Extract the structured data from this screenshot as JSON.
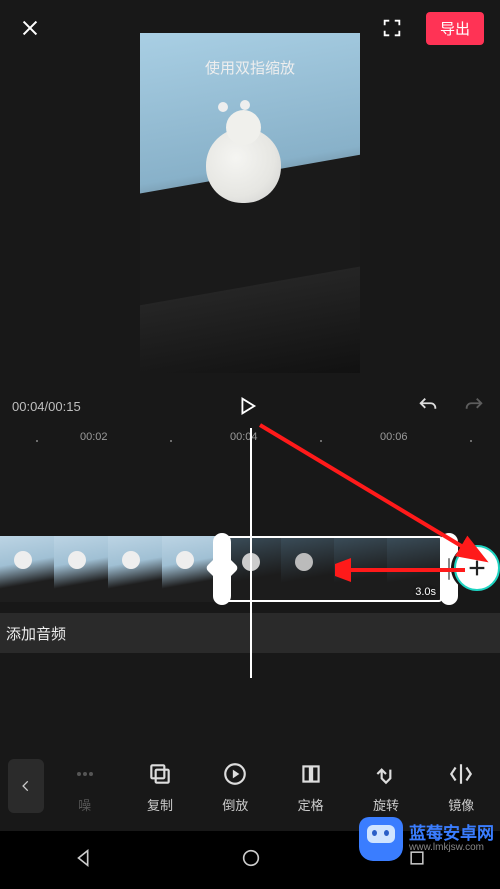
{
  "header": {
    "export_label": "导出",
    "zoom_hint": "使用双指缩放"
  },
  "transport": {
    "current_time": "00:04",
    "total_time": "00:15"
  },
  "ruler": {
    "marks": [
      "00:02",
      "00:04",
      "00:06"
    ]
  },
  "clip": {
    "duration_label": "3.0s"
  },
  "audio": {
    "add_label": "添加音频"
  },
  "toolbar": {
    "items": [
      {
        "key": "noise",
        "label": "噪",
        "dim": true
      },
      {
        "key": "copy",
        "label": "复制",
        "dim": false
      },
      {
        "key": "reverse",
        "label": "倒放",
        "dim": false
      },
      {
        "key": "freeze",
        "label": "定格",
        "dim": false
      },
      {
        "key": "rotate",
        "label": "旋转",
        "dim": false
      },
      {
        "key": "mirror",
        "label": "镜像",
        "dim": false
      }
    ]
  },
  "watermark": {
    "name": "蓝莓安卓网",
    "url": "www.lmkjsw.com"
  },
  "colors": {
    "accent": "#ff3355",
    "teal": "#1dd3c1"
  }
}
